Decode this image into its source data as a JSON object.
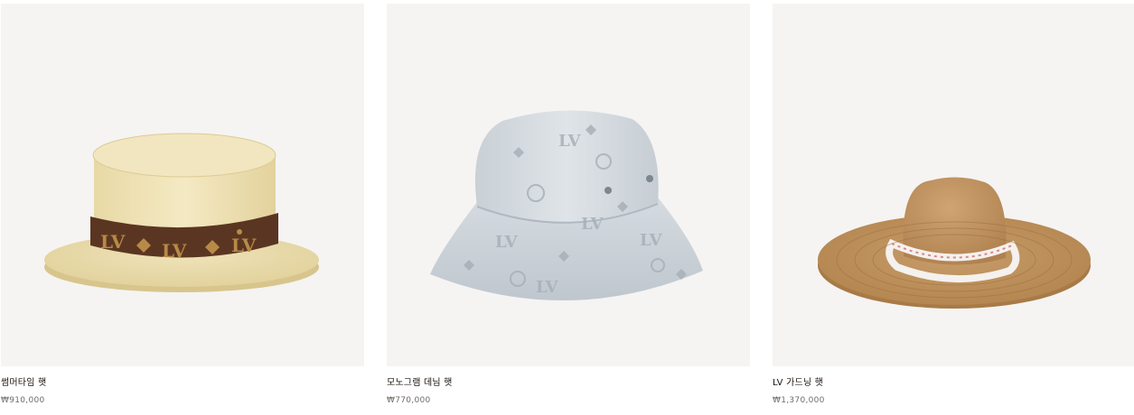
{
  "products": [
    {
      "name": "썸머타임 햇",
      "price": "₩910,000",
      "image_icon": "straw-boater-hat-icon"
    },
    {
      "name": "모노그램 데님 햇",
      "price": "₩770,000",
      "image_icon": "monogram-bucket-hat-icon"
    },
    {
      "name": "LV 가드닝 햇",
      "price": "₩1,370,000",
      "image_icon": "wide-brim-straw-hat-icon"
    }
  ],
  "colors": {
    "image_background": "#f5f4f3",
    "text_primary": "#19110b",
    "text_secondary": "#6f6a66"
  }
}
